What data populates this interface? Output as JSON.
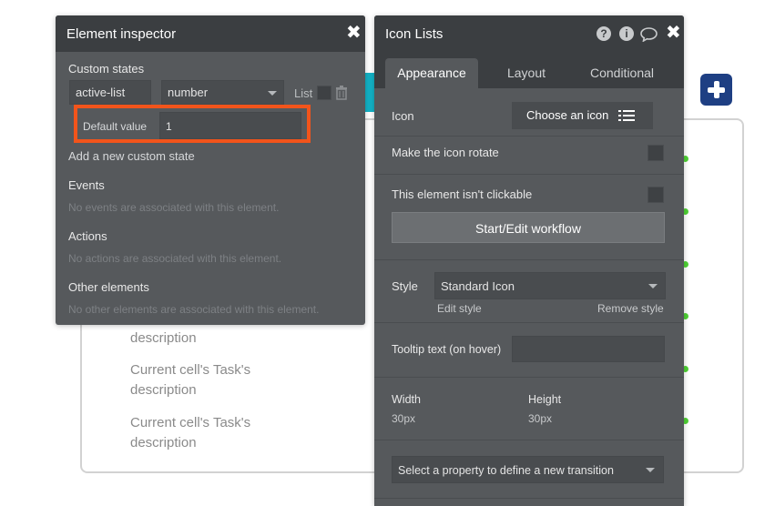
{
  "canvas": {
    "texts": [
      "description",
      "Current cell's Task's",
      "description",
      "Current cell's Task's",
      "description"
    ]
  },
  "inspector": {
    "title": "Element inspector",
    "custom_states_heading": "Custom states",
    "state_name": "active-list",
    "state_type": "number",
    "list_label": "List",
    "default_value_label": "Default value",
    "default_value": "1",
    "add_state_link": "Add a new custom state",
    "events_heading": "Events",
    "events_empty": "No events are associated with this element.",
    "actions_heading": "Actions",
    "actions_empty": "No actions are associated with this element.",
    "other_heading": "Other elements",
    "other_empty": "No other elements are associated with this element."
  },
  "iconlists": {
    "title": "Icon Lists",
    "tabs": [
      "Appearance",
      "Layout",
      "Conditional"
    ],
    "icon_label": "Icon",
    "choose_icon": "Choose an icon",
    "rotate_label": "Make the icon rotate",
    "not_clickable_label": "This element isn't clickable",
    "workflow_button": "Start/Edit workflow",
    "style_label": "Style",
    "style_value": "Standard Icon",
    "edit_style": "Edit style",
    "remove_style": "Remove style",
    "tooltip_label": "Tooltip text (on hover)",
    "tooltip_value": "",
    "width_label": "Width",
    "width_value": "30px",
    "height_label": "Height",
    "height_value": "30px",
    "transition_placeholder": "Select a property to define a new transition"
  },
  "colors": {
    "panel_bg": "#56595c",
    "panel_header": "#3b3e41",
    "highlight": "#f2541b",
    "plus_button": "#1e3f83",
    "accent_teal": "#13b1c5",
    "indicator_green": "#4fd135"
  }
}
